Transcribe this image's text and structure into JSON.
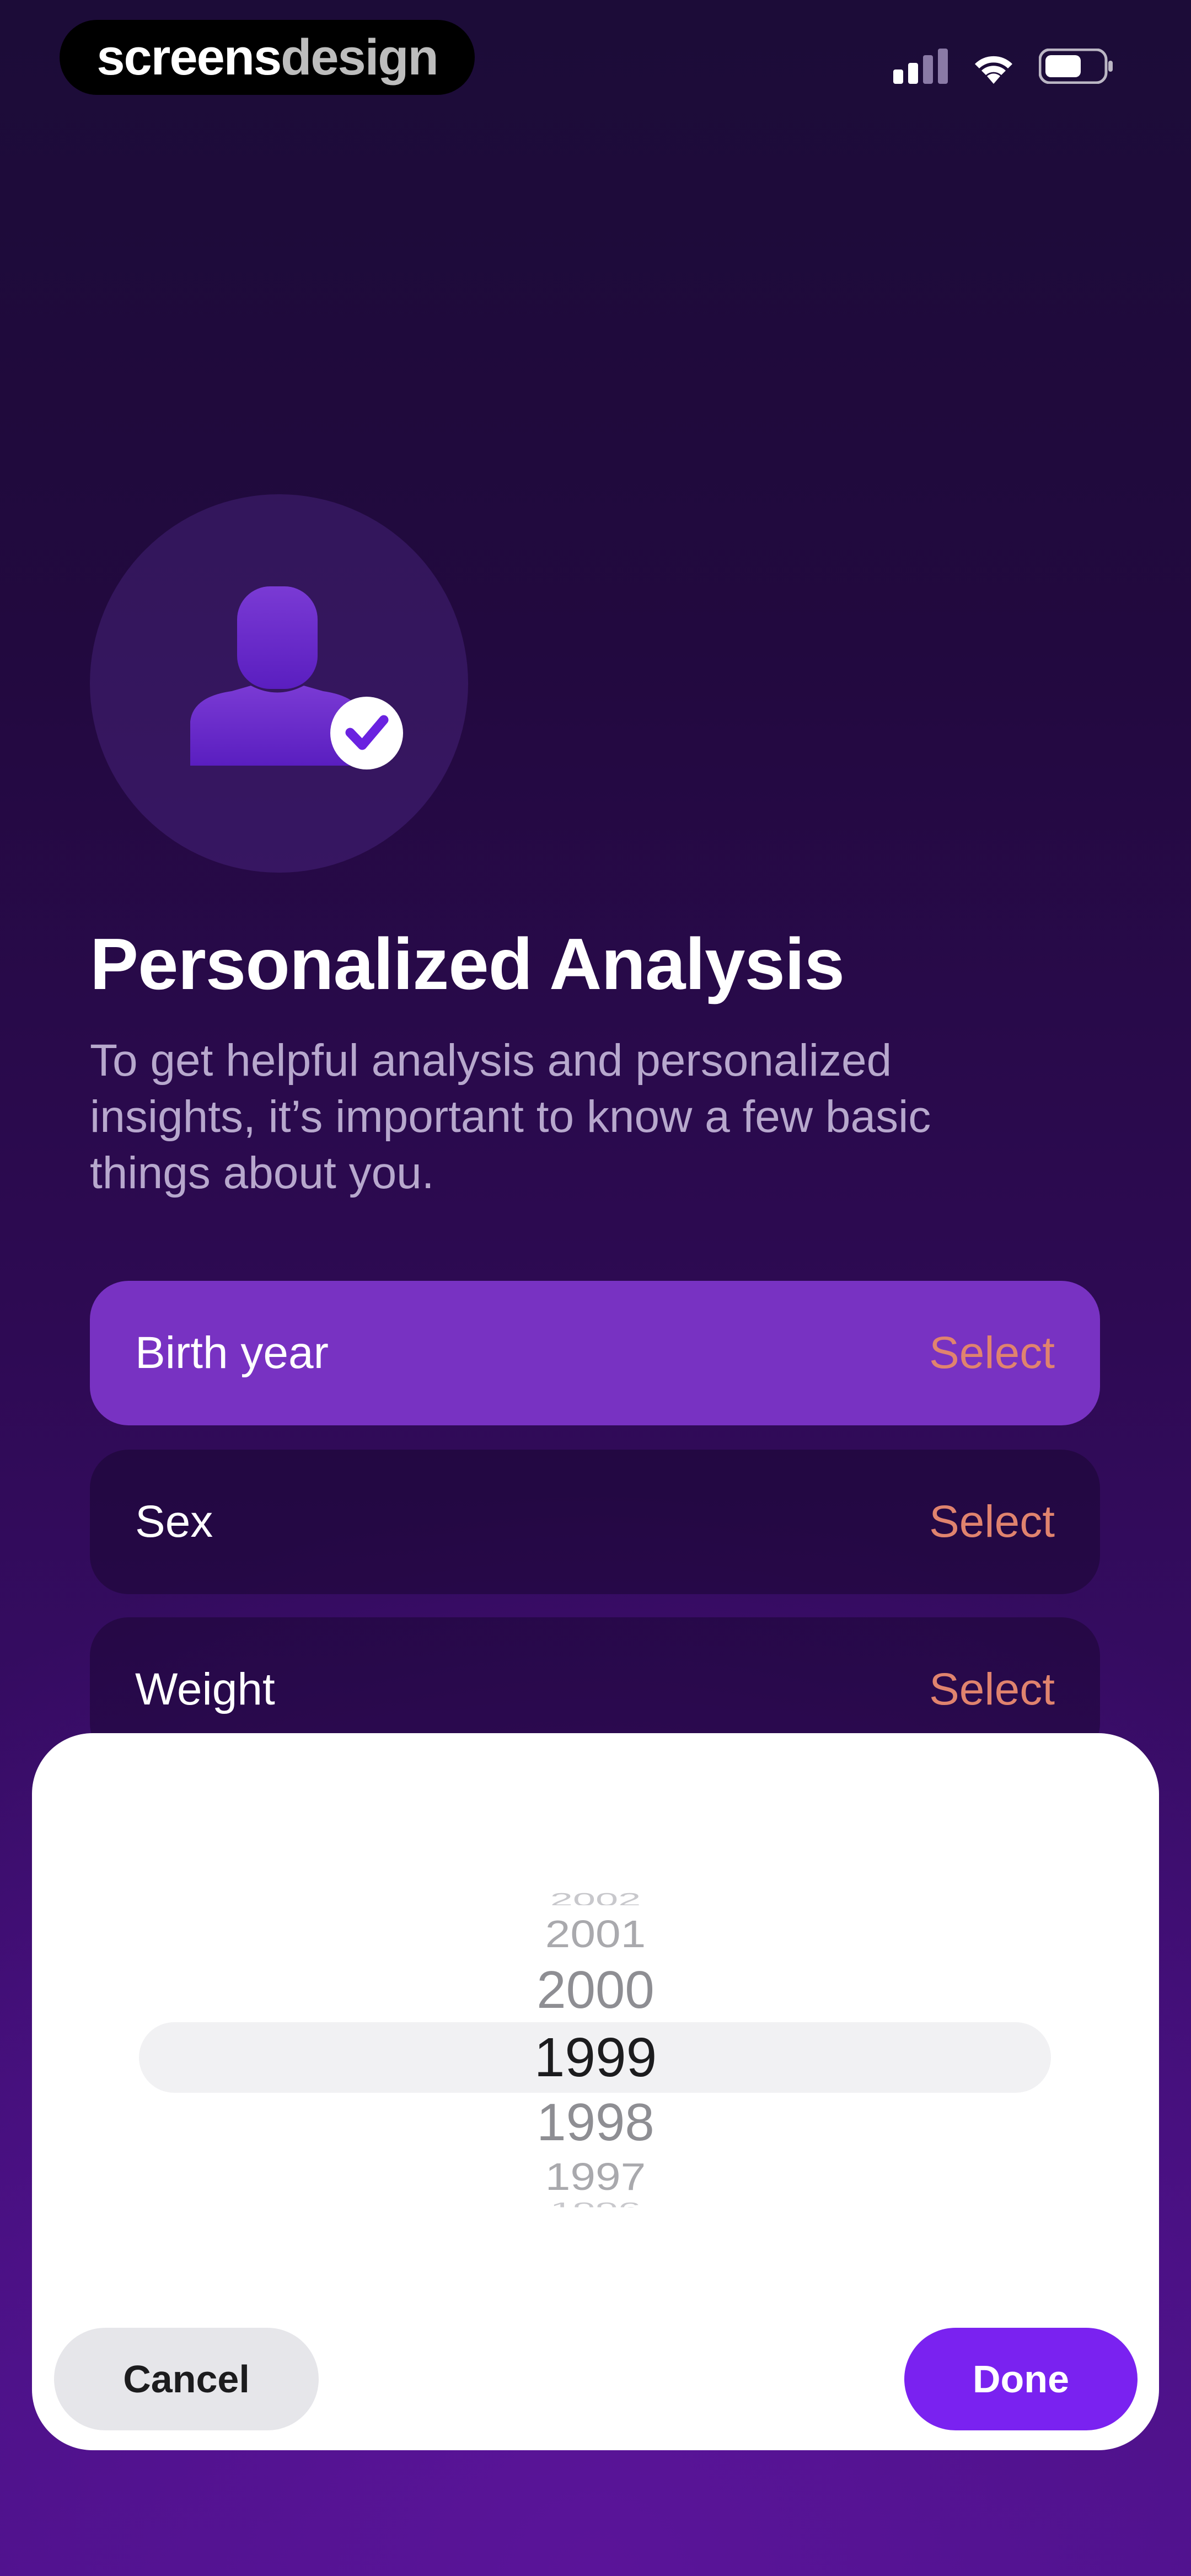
{
  "brand": {
    "part1": "screens",
    "part2": "design"
  },
  "header": {
    "title": "Personalized Analysis",
    "subtitle": "To get helpful analysis and personalized insights, it’s important to know a few basic things about you."
  },
  "fields": [
    {
      "label": "Birth year",
      "value": "Select"
    },
    {
      "label": "Sex",
      "value": "Select"
    },
    {
      "label": "Weight",
      "value": "Select"
    }
  ],
  "picker": {
    "years": [
      "2002",
      "2001",
      "2000",
      "1999",
      "1998",
      "1997",
      "1996"
    ],
    "selected": "1999"
  },
  "actions": {
    "cancel": "Cancel",
    "done": "Done"
  },
  "colors": {
    "accent": "#7a22f0",
    "active_row": "#7832c2",
    "select_text": "#e0836e"
  }
}
